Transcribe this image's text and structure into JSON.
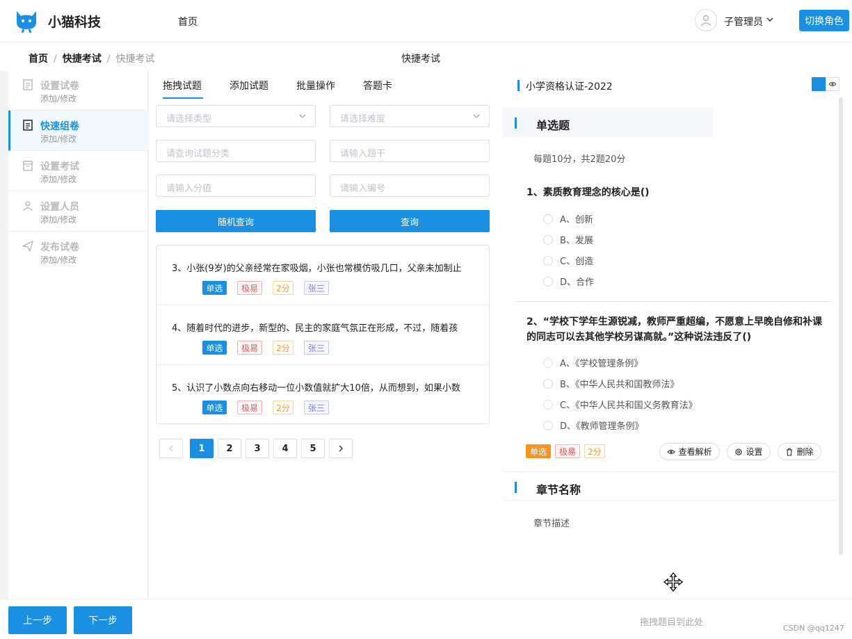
{
  "header": {
    "brand": "小猫科技",
    "nav_home": "首页",
    "user_name": "子管理员",
    "switch_role": "切换角色"
  },
  "breadcrumb": {
    "items": [
      "首页",
      "快捷考试",
      "快捷考试"
    ],
    "separator": "/",
    "center_title": "快捷考试"
  },
  "steps": [
    {
      "title": "设置试卷",
      "sub": "添加/修改",
      "icon": "document-icon"
    },
    {
      "title": "快速组卷",
      "sub": "添加/修改",
      "icon": "document-icon"
    },
    {
      "title": "设置考试",
      "sub": "添加/修改",
      "icon": "calendar-icon"
    },
    {
      "title": "设置人员",
      "sub": "添加/修改",
      "icon": "user-icon"
    },
    {
      "title": "发布试卷",
      "sub": "添加/修改",
      "icon": "send-icon"
    }
  ],
  "tabs": [
    "拖拽试题",
    "添加试题",
    "批量操作",
    "答题卡"
  ],
  "filters": {
    "type_placeholder": "请选择类型",
    "difficulty_placeholder": "请选择难度",
    "category_placeholder": "请查询试题分类",
    "stem_placeholder": "请输入题干",
    "score_placeholder": "请输入分值",
    "code_placeholder": "请输入编号",
    "random_query": "随机查询",
    "query": "查询"
  },
  "question_list": [
    {
      "text": "3、小张(9岁)的父亲经常在家吸烟，小张也常模仿吸几口，父亲未加制止",
      "type": "单选",
      "difficulty": "极易",
      "score": "2分",
      "author": "张三"
    },
    {
      "text": "4、随着时代的进步，新型的、民主的家庭气氛正在形成，不过，随着孩",
      "type": "单选",
      "difficulty": "极易",
      "score": "2分",
      "author": "张三"
    },
    {
      "text": "5、认识了小数点向右移动一位小数值就扩大10倍，从而想到，如果小数",
      "type": "单选",
      "difficulty": "极易",
      "score": "2分",
      "author": "张三"
    }
  ],
  "pagination": {
    "pages": [
      "1",
      "2",
      "3",
      "4",
      "5"
    ],
    "current": "1"
  },
  "paper": {
    "title": "小学资格认证-2022",
    "section_title": "单选题",
    "section_desc": "每题10分，共2题20分",
    "questions": [
      {
        "title": "1、素质教育理念的核心是()",
        "options": [
          "A、创新",
          "B、发展",
          "C、创造",
          "D、合作"
        ]
      },
      {
        "title": "2、“学校下学年生源锐减，教师严重超编，不愿意上早晚自修和补课的同志可以去其他学校另谋高就。”这种说法违反了()",
        "options": [
          "A、《学校管理条例》",
          "B、《中华人民共和国教师法》",
          "C、《中华人民共和国义务教育法》",
          "D、《教师管理条例》"
        ]
      }
    ],
    "tags": {
      "type": "单选",
      "difficulty": "极易",
      "score": "2分"
    },
    "actions": {
      "analysis": "查看解析",
      "settings": "设置",
      "delete": "删除"
    },
    "chapter_title": "章节名称",
    "chapter_desc": "章节描述",
    "drop_hint": "拖拽题目到此处"
  },
  "footer": {
    "prev": "上一步",
    "next": "下一步"
  },
  "watermark": "CSDN @qq1247",
  "colors": {
    "accent": "#1b90e3",
    "orange": "#f7931e"
  }
}
